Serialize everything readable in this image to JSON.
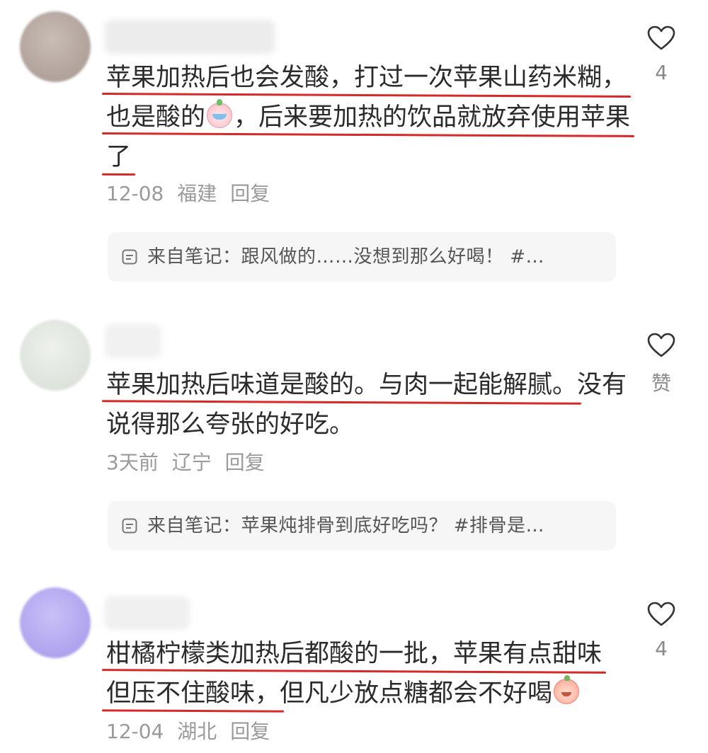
{
  "comments": [
    {
      "lines": [
        {
          "text": "苹果加热后也会发酸，打过一次苹果山药米糊，"
        },
        {
          "before": "也是酸的",
          "emoji": "crying-face-emoji",
          "after": "，后来要加热的饮品就放弃使用苹果"
        },
        {
          "text": "了"
        }
      ],
      "date": "12-08",
      "location": "福建",
      "reply_label": "回复",
      "note": "来自笔记：跟风做的……没想到那么好喝！ #…",
      "like_count": "4",
      "avatar_color": "#b4a69e"
    },
    {
      "lines": [
        {
          "underlined": "苹果加热后味道是酸的。与肉一起能解腻。",
          "rest": "没有"
        },
        {
          "text": "说得那么夸张的好吃。"
        }
      ],
      "date": "3天前",
      "location": "辽宁",
      "reply_label": "回复",
      "note": "来自笔记：苹果炖排骨到底好吃吗？ #排骨是…",
      "like_count": "赞",
      "avatar_color": "#dfe4dd"
    },
    {
      "lines": [
        {
          "text": "柑橘柠檬类加热后都酸的一批，苹果有点甜味"
        },
        {
          "underlined": "但压不住酸味，",
          "rest": "但凡少放点糖都会不好喝",
          "emoji": "peach-emoji"
        }
      ],
      "date": "12-04",
      "location": "湖北",
      "reply_label": "回复",
      "like_count": "4",
      "avatar_color": "#b3a8ee"
    }
  ],
  "colors": {
    "underline": "#d42a2a",
    "text": "#2b2b2b",
    "meta": "#9a9a9a",
    "note_bg": "#f6f6f6"
  }
}
